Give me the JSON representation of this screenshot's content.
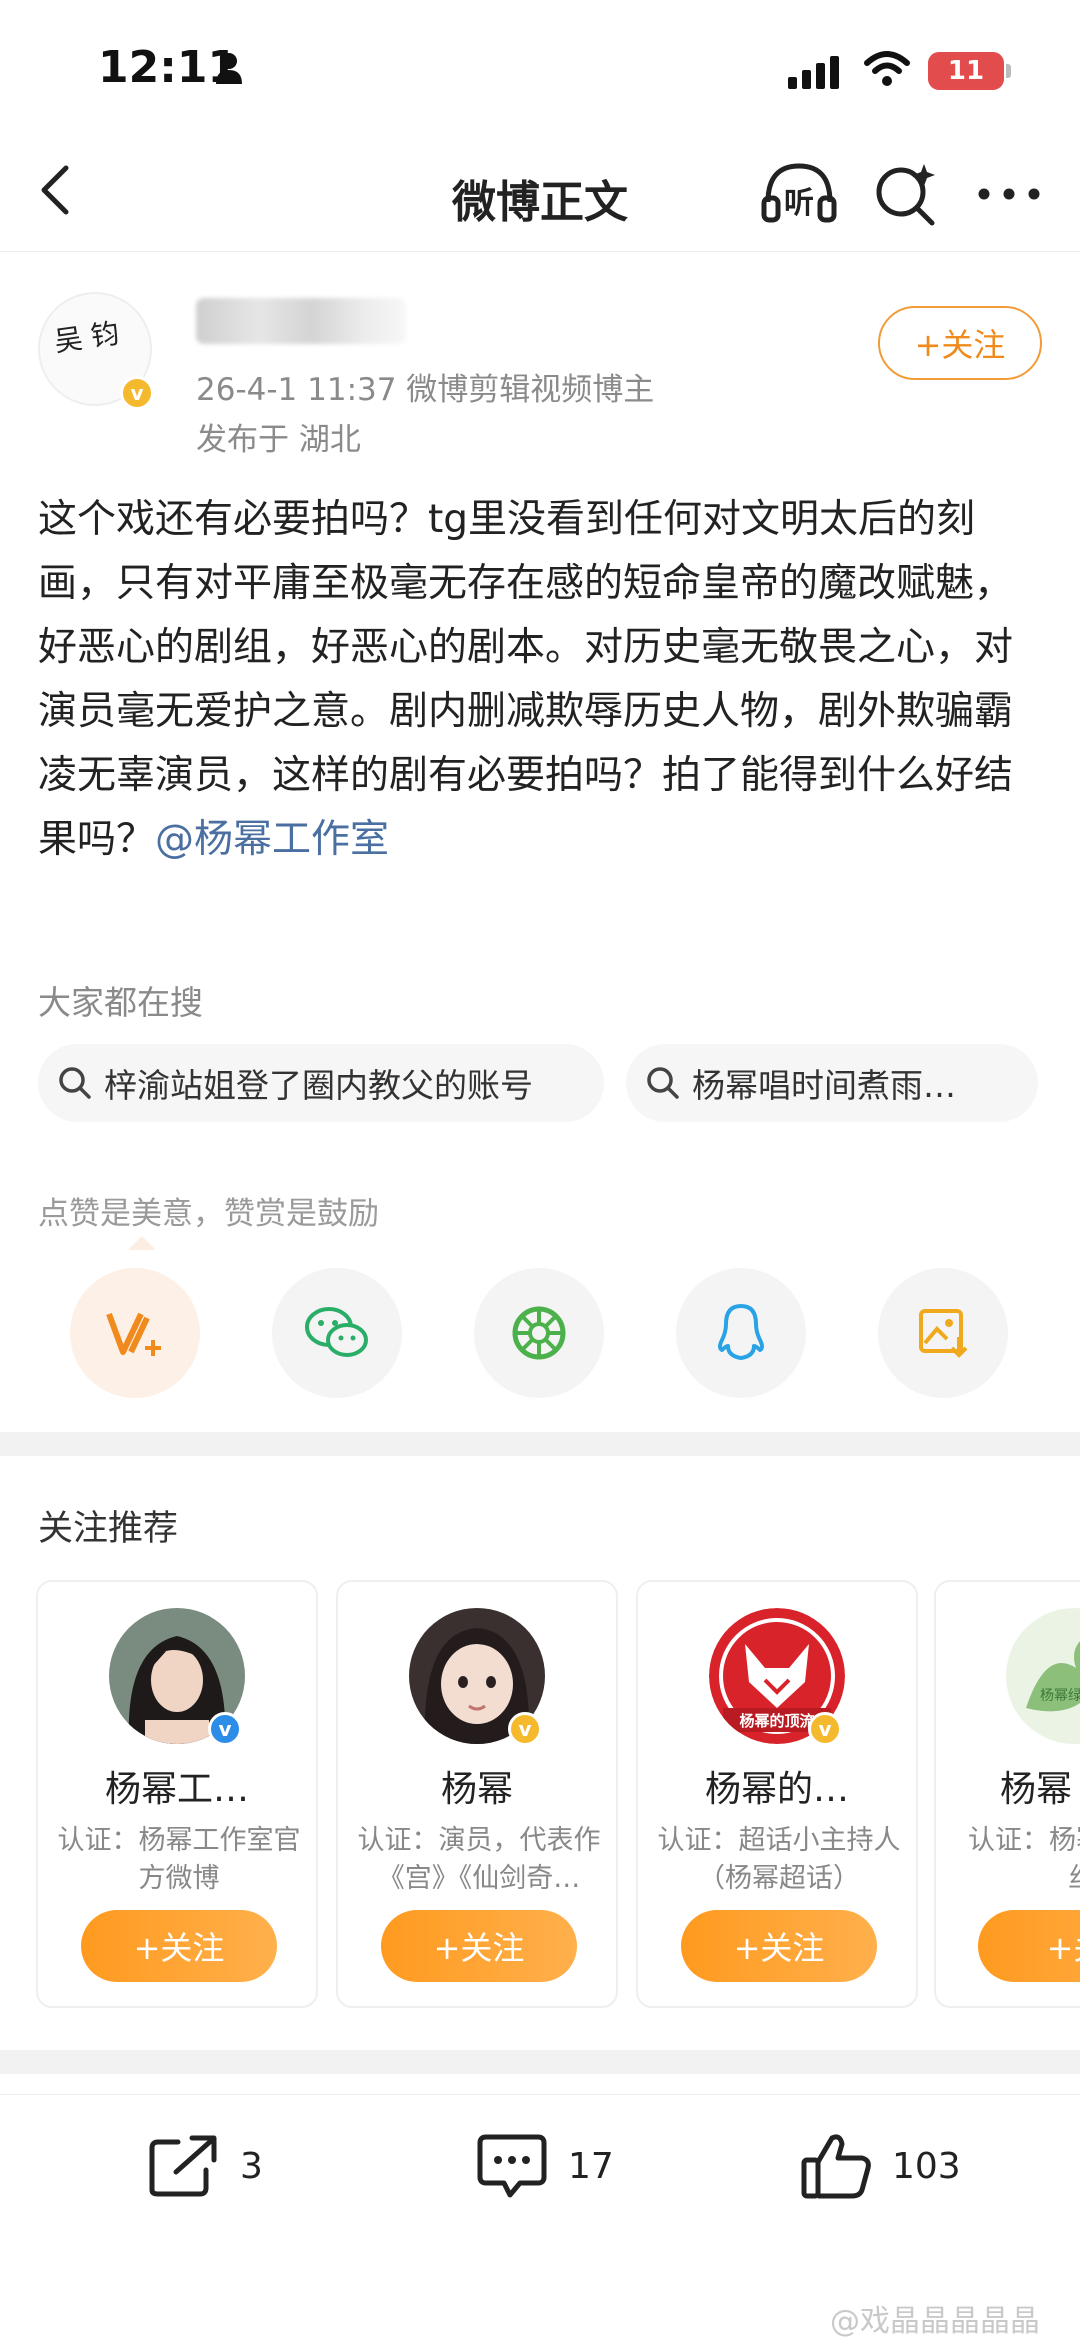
{
  "status_bar": {
    "time": "12:11",
    "battery": "11"
  },
  "nav": {
    "title": "微博正文",
    "listen_label": "听"
  },
  "post": {
    "meta": "26-4-1 11:37  微博剪辑视频博主",
    "location": "发布于 湖北",
    "follow_label": "+关注",
    "body": "这个戏还有必要拍吗？tg里没看到任何对文明太后的刻画，只有对平庸至极毫无存在感的短命皇帝的魔改赋魅，好恶心的剧组，好恶心的剧本。对历史毫无敬畏之心，对演员毫无爱护之意。剧内删减欺辱历史人物，剧外欺骗霸凌无辜演员，这样的剧有必要拍吗？拍了能得到什么好结果吗？",
    "mention": "@杨幂工作室"
  },
  "hot_search": {
    "label": "大家都在搜",
    "items": [
      "梓渝站姐登了圈内教父的账号",
      "杨幂唱时间煮雨…"
    ]
  },
  "encourage_text": "点赞是美意，赞赏是鼓励",
  "share_icons": [
    "v-plus-icon",
    "wechat-icon",
    "moments-icon",
    "qq-icon",
    "save-image-icon"
  ],
  "recommend": {
    "title": "关注推荐",
    "cards": [
      {
        "name": "杨幂工…",
        "desc": "认证：杨幂工作室官方微博",
        "follow": "+关注",
        "badge": "blue"
      },
      {
        "name": "杨幂",
        "desc": "认证：演员，代表作《宫》《仙剑奇…",
        "follow": "+关注",
        "badge": "gold"
      },
      {
        "name": "杨幂的…",
        "desc": "认证：超话小主持人（杨幂超话）",
        "follow": "+关注",
        "badge": "gold",
        "logo_text": "杨幂的顶流"
      },
      {
        "name": "杨幂",
        "desc": "认证：杨幂",
        "desc2": "丝",
        "follow": "+关",
        "logo_text": "杨幂绿茶"
      }
    ]
  },
  "actions": {
    "repost": "3",
    "comment": "17",
    "like": "103"
  },
  "watermark": "@戏晶晶晶晶晶",
  "colors": {
    "accent": "#f08a1c",
    "mention": "#4a6fa0",
    "verified_gold": "#f5b92d",
    "verified_blue": "#2b8de8"
  }
}
